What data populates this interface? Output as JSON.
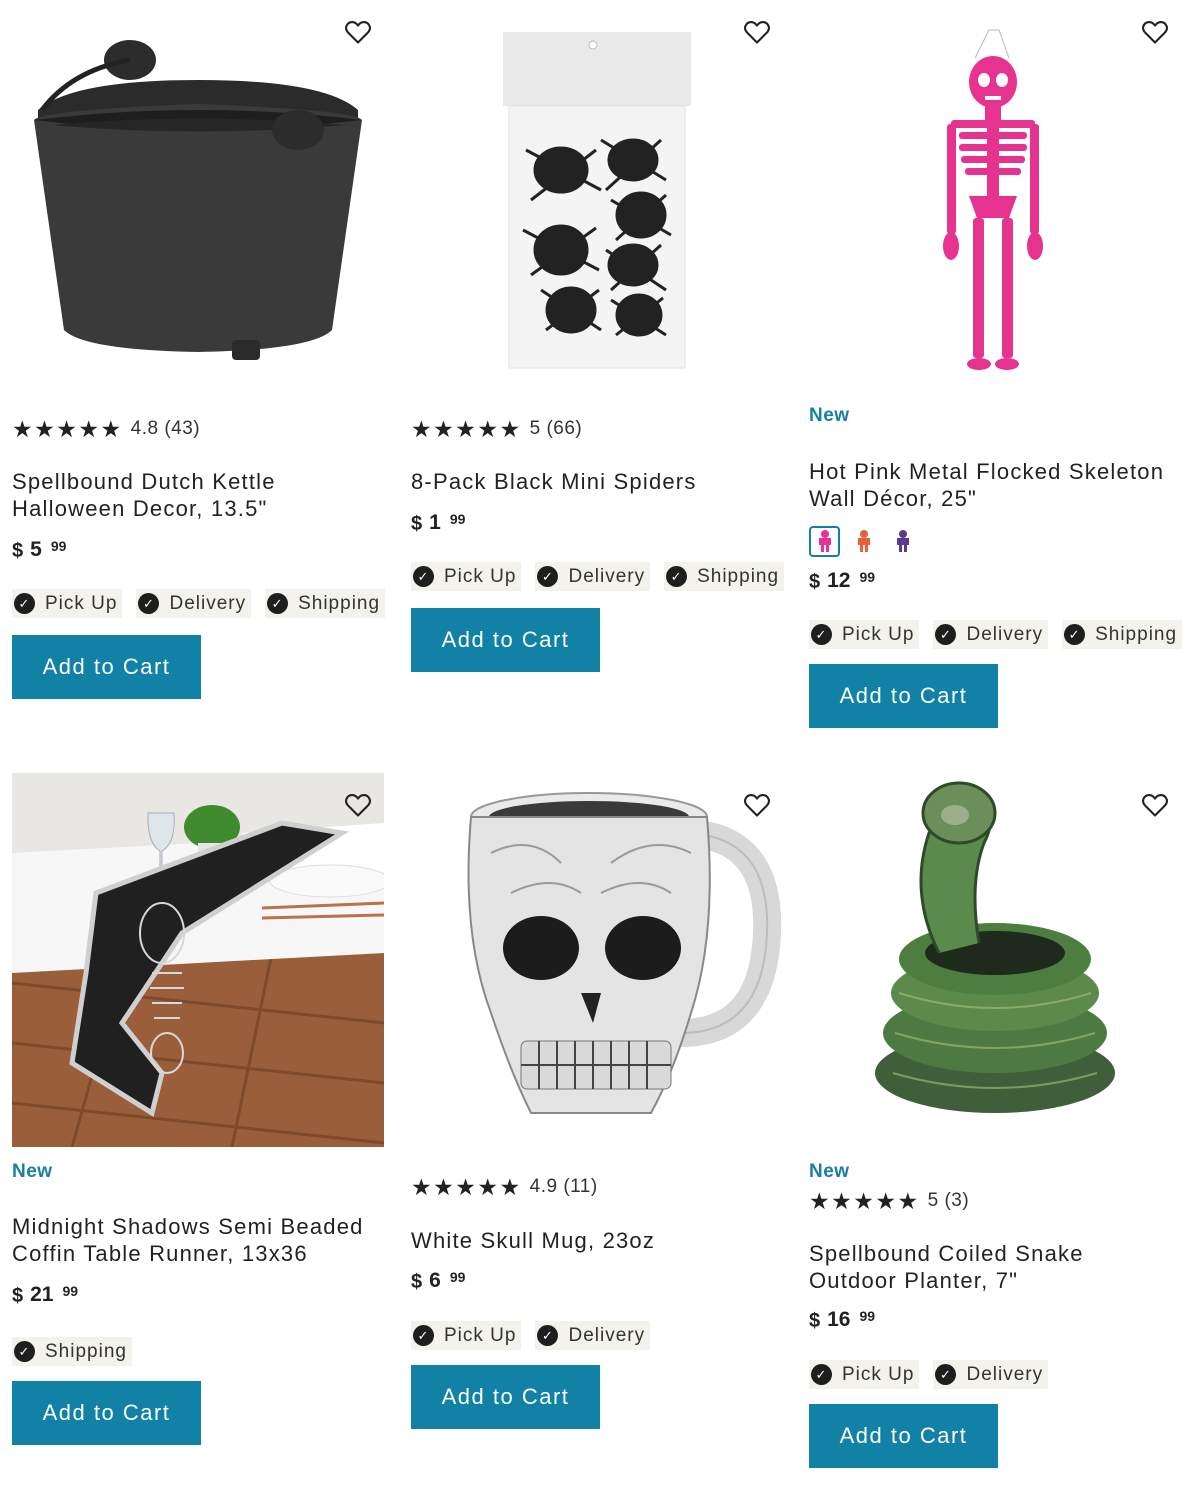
{
  "colors": {
    "accent": "#1181a5",
    "new_badge": "#1a7fa0",
    "chip_bg": "#f3f2ec"
  },
  "products": [
    {
      "badge": "",
      "rating_value": 5,
      "rating": "4.8 (43)",
      "title_lines": [
        "Spellbound Dutch Kettle",
        "Halloween Decor, 13.5\""
      ],
      "price": {
        "dollar": "$",
        "whole": "5",
        "cents": "99"
      },
      "fulfillment": [
        "Pick Up",
        "Delivery",
        "Shipping"
      ],
      "button": "Add to Cart",
      "image_icon": "cauldron-image"
    },
    {
      "badge": "",
      "rating_value": 5,
      "rating": "5 (66)",
      "title_lines": [
        "8-Pack Black Mini Spiders"
      ],
      "price": {
        "dollar": "$",
        "whole": "1",
        "cents": "99"
      },
      "fulfillment": [
        "Pick Up",
        "Delivery",
        "Shipping"
      ],
      "button": "Add to Cart",
      "image_icon": "spiders-image"
    },
    {
      "badge": "New",
      "rating": "",
      "title_lines": [
        "Hot Pink Metal Flocked Skeleton",
        "Wall Décor, 25\""
      ],
      "swatches": [
        "#e8329a",
        "#e8603a",
        "#5a3a8c"
      ],
      "price": {
        "dollar": "$",
        "whole": "12",
        "cents": "99"
      },
      "fulfillment": [
        "Pick Up",
        "Delivery",
        "Shipping"
      ],
      "button": "Add to Cart",
      "image_icon": "skeleton-image"
    },
    {
      "badge": "New",
      "rating": "",
      "title_lines": [
        "Midnight Shadows Semi Beaded",
        "Coffin Table Runner, 13x36"
      ],
      "price": {
        "dollar": "$",
        "whole": "21",
        "cents": "99"
      },
      "fulfillment": [
        "Shipping"
      ],
      "button": "Add to Cart",
      "image_icon": "table-runner-image"
    },
    {
      "badge": "",
      "rating_value": 5,
      "rating": "4.9 (11)",
      "title_lines": [
        "White Skull Mug, 23oz"
      ],
      "price": {
        "dollar": "$",
        "whole": "6",
        "cents": "99"
      },
      "fulfillment": [
        "Pick Up",
        "Delivery"
      ],
      "button": "Add to Cart",
      "image_icon": "skull-mug-image"
    },
    {
      "badge": "New",
      "rating_value": 5,
      "rating": "5 (3)",
      "title_lines": [
        "Spellbound Coiled Snake",
        "Outdoor Planter, 7\""
      ],
      "price": {
        "dollar": "$",
        "whole": "16",
        "cents": "99"
      },
      "fulfillment": [
        "Pick Up",
        "Delivery"
      ],
      "button": "Add to Cart",
      "image_icon": "snake-planter-image"
    }
  ]
}
